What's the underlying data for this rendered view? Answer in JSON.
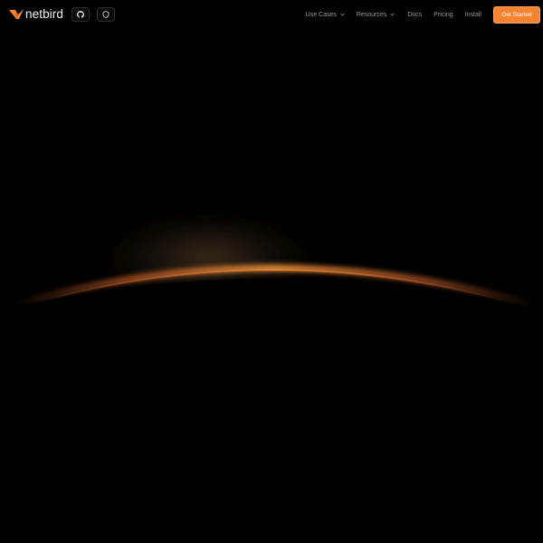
{
  "brand": {
    "name": "netbird",
    "accent": "#f68330"
  },
  "header": {
    "icons": {
      "github": "github-icon",
      "shield": "shield-icon"
    },
    "nav": {
      "use_cases": "Use Cases",
      "resources": "Resources",
      "docs": "Docs",
      "pricing": "Pricing",
      "install": "Install"
    },
    "cta_label": "Get Started"
  },
  "theme": {
    "background": "#000000",
    "glow": "#c2461a",
    "glow_highlight": "#f08a3a"
  }
}
